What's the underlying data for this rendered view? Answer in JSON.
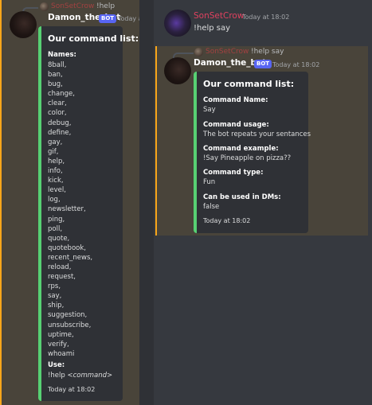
{
  "left": {
    "reply": {
      "author": "SonSetCrow",
      "text": "!help"
    },
    "message": {
      "author": "Damon_the_bot",
      "badge": "BOT",
      "timestamp": "Today at"
    },
    "embed": {
      "title": "Our command list:",
      "names_label": "Names:",
      "commands": [
        "8ball,",
        "ban,",
        "bug,",
        "change,",
        "clear,",
        "color,",
        "debug,",
        "define,",
        "gay,",
        "gif,",
        "help,",
        "info,",
        "kick,",
        "level,",
        "log,",
        "newsletter,",
        "ping,",
        "poll,",
        "quote,",
        "quotebook,",
        "recent_news,",
        "reload,",
        "request,",
        "rps,",
        "say,",
        "ship,",
        "suggestion,",
        "unsubscribe,",
        "uptime,",
        "verify,",
        "whoami"
      ],
      "use_label": "Use:",
      "use_prefix": "!help ",
      "use_arg": "<command>",
      "footer": "Today at 18:02"
    }
  },
  "right": {
    "user_message": {
      "author": "SonSetCrow",
      "timestamp": "Today at 18:02",
      "text": "!help say"
    },
    "reply": {
      "author": "SonSetCrow",
      "text": "!help say"
    },
    "bot_message": {
      "author": "Damon_the_bot",
      "badge": "BOT",
      "timestamp": "Today at 18:02"
    },
    "embed": {
      "title": "Our command list:",
      "fields": [
        {
          "name": "Command Name:",
          "value": "Say"
        },
        {
          "name": "Command usage:",
          "value": "The bot repeats your sentances"
        },
        {
          "name": "Command example:",
          "value": "!Say Pineapple on pizza??"
        },
        {
          "name": "Command type:",
          "value": "Fun"
        },
        {
          "name": "Can be used in DMs:",
          "value": "false"
        }
      ],
      "footer": "Today at 18:02"
    }
  },
  "colors": {
    "embed_accent": "#57d173",
    "highlight_bar": "#faa61a",
    "bot_badge": "#5865f2",
    "user_name": "#e0415f"
  }
}
